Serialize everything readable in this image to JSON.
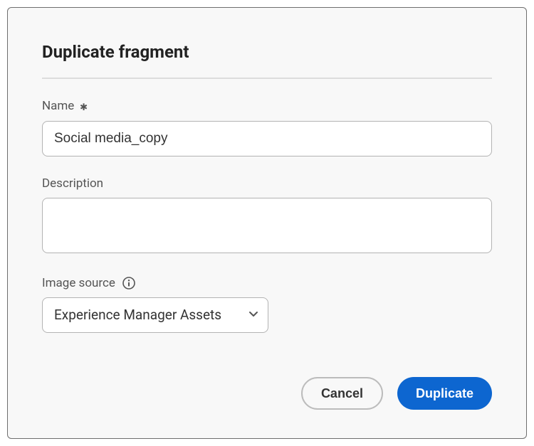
{
  "dialog": {
    "title": "Duplicate fragment"
  },
  "fields": {
    "name": {
      "label": "Name",
      "value": "Social media_copy",
      "required_marker": "✱"
    },
    "description": {
      "label": "Description",
      "value": ""
    },
    "imageSource": {
      "label": "Image source",
      "selected": "Experience Manager Assets"
    }
  },
  "buttons": {
    "cancel": "Cancel",
    "confirm": "Duplicate"
  }
}
